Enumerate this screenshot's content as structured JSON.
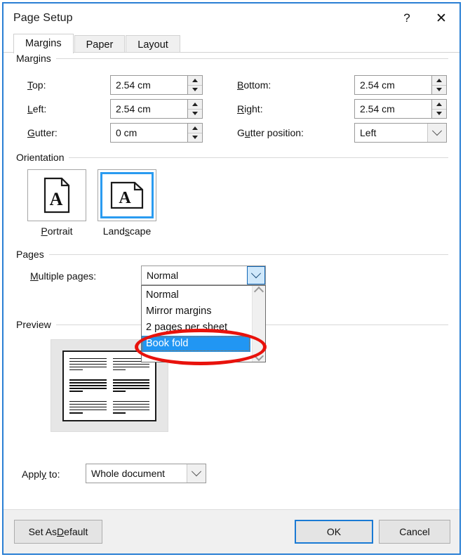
{
  "dialog": {
    "title": "Page Setup",
    "help_icon": "question-mark-icon",
    "close_icon": "close-x-icon",
    "help_label": "?",
    "close_label": "✕"
  },
  "tabs": [
    {
      "label": "Margins",
      "active": true
    },
    {
      "label": "Paper",
      "active": false
    },
    {
      "label": "Layout",
      "active": false
    }
  ],
  "margins": {
    "group_label": "Margins",
    "top": {
      "label": "Top:",
      "accesskey": "T",
      "value": "2.54 cm"
    },
    "bottom": {
      "label": "Bottom:",
      "accesskey": "B",
      "value": "2.54 cm"
    },
    "left": {
      "label": "Left:",
      "accesskey": "L",
      "value": "2.54 cm"
    },
    "right": {
      "label": "Right:",
      "accesskey": "R",
      "value": "2.54 cm"
    },
    "gutter": {
      "label": "Gutter:",
      "accesskey": "G",
      "value": "0 cm"
    },
    "gutter_position": {
      "label": "Gutter position:",
      "accesskey": "u",
      "value": "Left"
    }
  },
  "orientation": {
    "group_label": "Orientation",
    "options": [
      {
        "label": "Portrait",
        "accesskey": "P",
        "selected": false,
        "icon": "portrait-page-icon"
      },
      {
        "label": "Landscape",
        "accesskey": "s",
        "selected": true,
        "icon": "landscape-page-icon"
      }
    ]
  },
  "pages": {
    "group_label": "Pages",
    "multiple_pages": {
      "label": "Multiple pages:",
      "accesskey": "M",
      "value": "Normal",
      "expanded": true,
      "options": [
        {
          "label": "Normal",
          "selected": false
        },
        {
          "label": "Mirror margins",
          "selected": false
        },
        {
          "label": "2 pages per sheet",
          "selected": false
        },
        {
          "label": "Book fold",
          "selected": true
        }
      ]
    }
  },
  "preview": {
    "group_label": "Preview",
    "page_orientation": "landscape",
    "columns": 2,
    "paragraphs_per_column": 3,
    "lines_per_paragraph": 4
  },
  "apply_to": {
    "label": "Apply to:",
    "accesskey": "y",
    "value": "Whole document"
  },
  "footer": {
    "set_as_default": {
      "label": "Set As Default",
      "accesskey": "D"
    },
    "ok": "OK",
    "cancel": "Cancel"
  },
  "annotation": {
    "type": "ellipse-highlight",
    "color": "#e8120c",
    "targets": "Book fold"
  },
  "colors": {
    "dialog_border": "#2a7fd4",
    "selection_blue": "#2196f3",
    "orientation_selected": "#2a9bf0",
    "annotation_red": "#e8120c",
    "default_button_border": "#1a7ad4"
  }
}
